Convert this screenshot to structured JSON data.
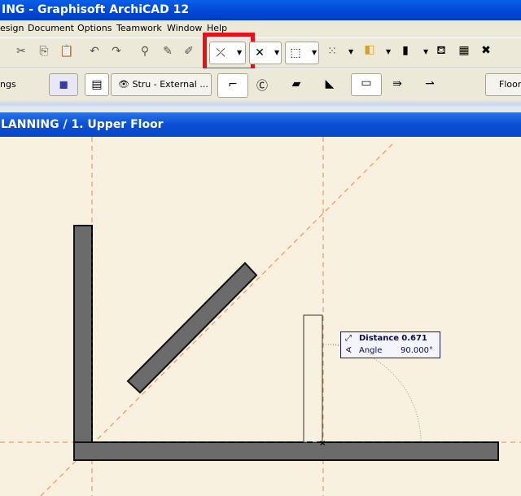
{
  "window": {
    "title": "ING - Graphisoft ArchiCAD 12"
  },
  "menu": [
    "esign",
    "Document",
    "Options",
    "Teamwork",
    "Window",
    "Help"
  ],
  "toolbar2": {
    "left_label": "ngs",
    "layer_combo": "Stru - External ...",
    "floor_button": "Floor"
  },
  "document": {
    "title": "LANNING / 1. Upper Floor"
  },
  "tracker": {
    "distance_label": "Distance",
    "distance_value": "0.671",
    "angle_label": "Angle",
    "angle_value": "90.000°"
  },
  "colors": {
    "highlight": "#e8101a",
    "guide": "#e8874a",
    "wall": "#6b6b6b",
    "canvas": "#f8f1e0"
  }
}
